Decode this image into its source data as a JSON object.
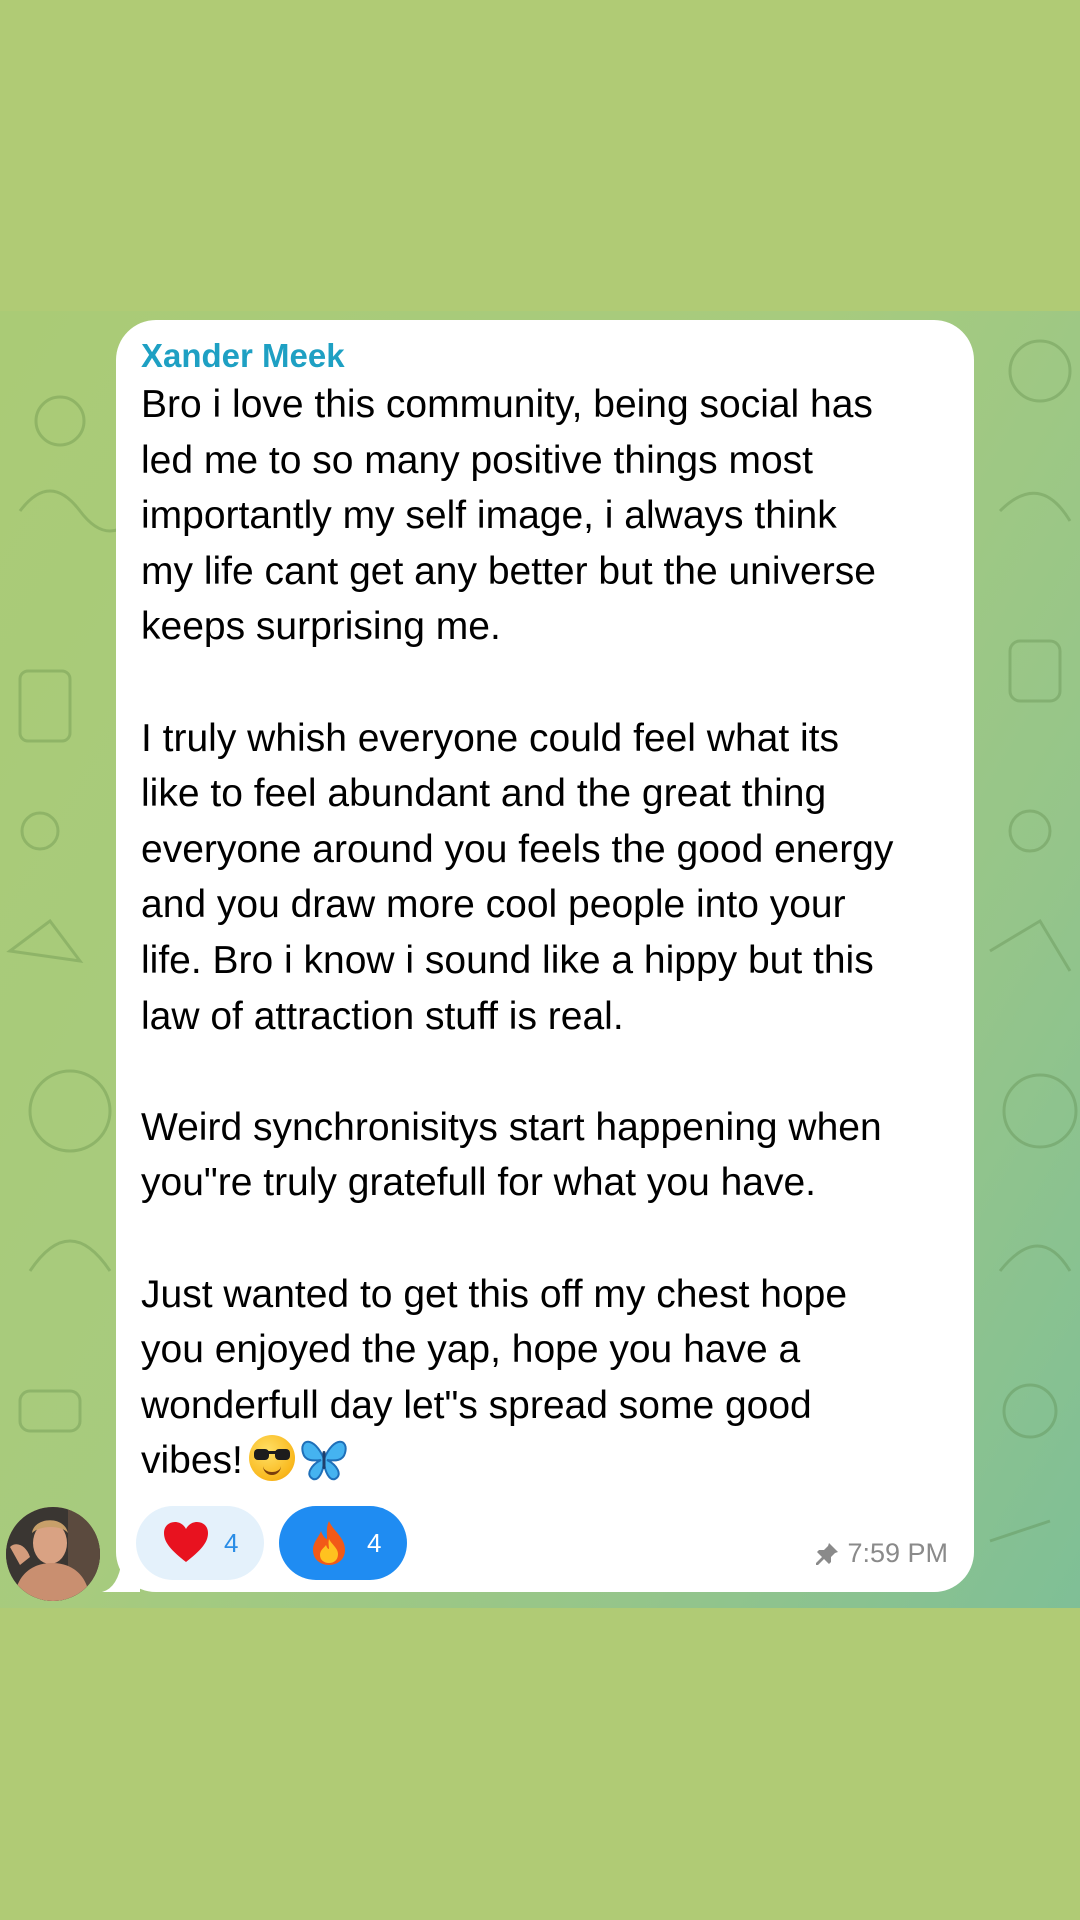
{
  "message": {
    "sender": "Xander Meek",
    "paragraphs": [
      "Bro i love this community, being social has\nled me to so many positive things most\nimportantly my self image, i always think\nmy life cant get any better but the universe\nkeeps surprising me.",
      "I truly whish everyone could feel what its\nlike to feel abundant and the great thing\neveryone around you feels the good energy\nand you draw more cool people into your\nlife. Bro i know i sound like a hippy but this\nlaw of attraction stuff is real.",
      "Weird synchronisitys start happening when\nyou\"re truly gratefull for what you have.",
      "Just wanted to get this off my chest hope\nyou enjoyed the yap, hope you have a\nwonderfull day let\"s spread some good\nvibes!"
    ],
    "trailing_emoji": [
      "smiling-face-with-sunglasses-icon",
      "butterfly-icon"
    ],
    "reactions": [
      {
        "icon": "heart-icon",
        "count": "4",
        "selected": false
      },
      {
        "icon": "fire-icon",
        "count": "4",
        "selected": true
      }
    ],
    "pinned": true,
    "time": "7:59 PM"
  },
  "colors": {
    "page_background": "#b0cb75",
    "sender_name": "#1ea0c3",
    "reaction_selected": "#1f8cf2",
    "reaction_unselected": "#e4f1fb"
  }
}
